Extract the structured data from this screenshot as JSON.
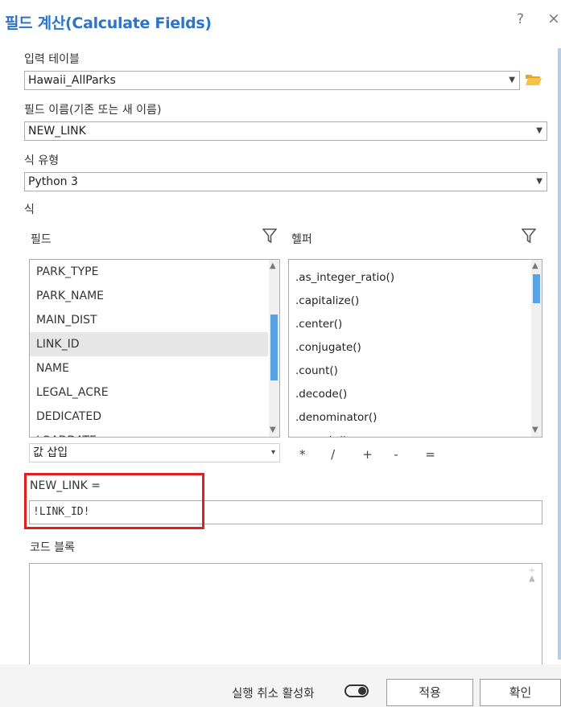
{
  "dialog": {
    "title": "필드 계산(Calculate Fields)",
    "help_glyph": "?",
    "close_glyph": "×"
  },
  "input_table": {
    "label": "입력 테이블",
    "value": "Hawaii_AllParks"
  },
  "field_name": {
    "label": "필드 이름(기존 또는 새 이름)",
    "value": "NEW_LINK"
  },
  "expression_type": {
    "label": "식 유형",
    "value": "Python 3"
  },
  "expression": {
    "label": "식",
    "fields_header": "필드",
    "helpers_header": "헬퍼",
    "fields": [
      "PARK_TYPE",
      "PARK_NAME",
      "MAIN_DIST",
      "LINK_ID",
      "NAME",
      "LEGAL_ACRE",
      "DEDICATED",
      "LOADDATE"
    ],
    "selected_field": "LINK_ID",
    "helpers": [
      ".as_integer_ratio()",
      ".capitalize()",
      ".center()",
      ".conjugate()",
      ".count()",
      ".decode()",
      ".denominator()",
      ".encode()"
    ],
    "insert_values": "값 삽입",
    "operators": [
      "*",
      "/",
      "+",
      "-",
      "="
    ],
    "target": "NEW_LINK =",
    "value": "!LINK_ID!"
  },
  "code_block": {
    "label": "코드 블록",
    "value": ""
  },
  "footer": {
    "undo_label": "실행 취소 활성화",
    "apply": "적용",
    "ok": "확인"
  },
  "colors": {
    "title": "#2a74c9",
    "highlight": "#e02020",
    "scroll_thumb": "#5aa3e2"
  }
}
